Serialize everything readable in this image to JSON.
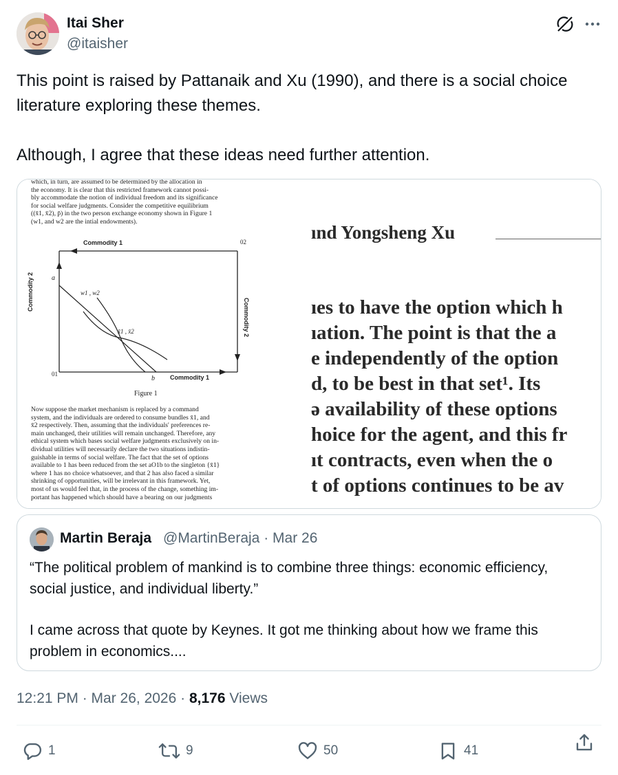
{
  "author": {
    "name": "Itai Sher",
    "handle": "@itaisher"
  },
  "icons": {
    "grok": "grok-slash-icon",
    "more": "more-horizontal-icon",
    "reply": "reply-icon",
    "repost": "repost-icon",
    "like": "heart-icon",
    "bookmark": "bookmark-icon",
    "share": "share-icon"
  },
  "tweet": {
    "paragraph1": "This point is raised by Pattanaik and Xu (1990), and there is a social choice literature exploring these themes.",
    "paragraph2": "Although, I agree that these ideas need further attention."
  },
  "media": {
    "left": {
      "top_text": "which, in turn, are assumed to be determined by the allocation in\nthe economy. It is clear that this restricted framework cannot possi-\nbly accommodate the notion of individual freedom and its significance\nfor social welfare judgments. Consider the competitive equilibrium\n((x̄1, x̄2), p̄) in the two person exchange economy shown in Figure 1\n(w1, and w2 are the intial endowments).",
      "figure": {
        "commodity_top": "Commodity 1",
        "commodity_bottom": "Commodity 1",
        "commodity_left": "Commodity 2",
        "commodity_right": "Commodity 2",
        "origin_1": "01",
        "origin_2": "02",
        "label_a": "a",
        "label_b": "b",
        "label_w": "w1 , w2",
        "label_x": "x̄1 , x̄2"
      },
      "caption": "Figure 1",
      "bottom_text": "Now suppose the market mechanism is replaced by a command\nsystem, and the individuals are ordered to consume bundles x̄1, and\nx̄2 respectively. Then, assuming that the individuals' preferences re-\nmain unchanged, their utilities will remain unchanged. Therefore, any\nethical system which bases social welfare judgments exclusively on in-\ndividual utilities will necessarily declare the two situations indistin-\nguishable in terms of social welfare. The fact that the set of options\navailable to 1 has been reduced from the set aO1b to the singleton {x̄1}\nwhere 1 has no choice whatsoever, and that 2 has also faced a similar\nshrinking of opportunities, will be irrelevant in this framework. Yet,\nmost of us would feel that, in the process of the change, something im-\nportant has happened which should have a bearing on our judgments"
    },
    "right": {
      "heading": "ınd Yongsheng Xu",
      "lines": [
        "ıes to have the option which h",
        "ıation. The point is that the a",
        "e independently of the option",
        "d, to be best in that set¹. Its",
        "ə availability of these options",
        "hoice for the agent, and this fr",
        "ıt contracts, even when the o",
        "t of options continues to be av"
      ]
    }
  },
  "quoted": {
    "name": "Martin Beraja",
    "meta": "@MartinBeraja · Mar 26",
    "paragraph1": "“The political problem of mankind is to combine three things: economic efficiency, social justice, and individual liberty.”",
    "paragraph2": "I came across that quote by Keynes. It got me thinking about how we frame this problem in economics...."
  },
  "footer": {
    "time": "12:21 PM · Mar 26, 2026 · ",
    "views_count": "8,176",
    "views_label": " Views"
  },
  "stats": {
    "replies": "1",
    "reposts": "9",
    "likes": "50",
    "bookmarks": "41"
  }
}
